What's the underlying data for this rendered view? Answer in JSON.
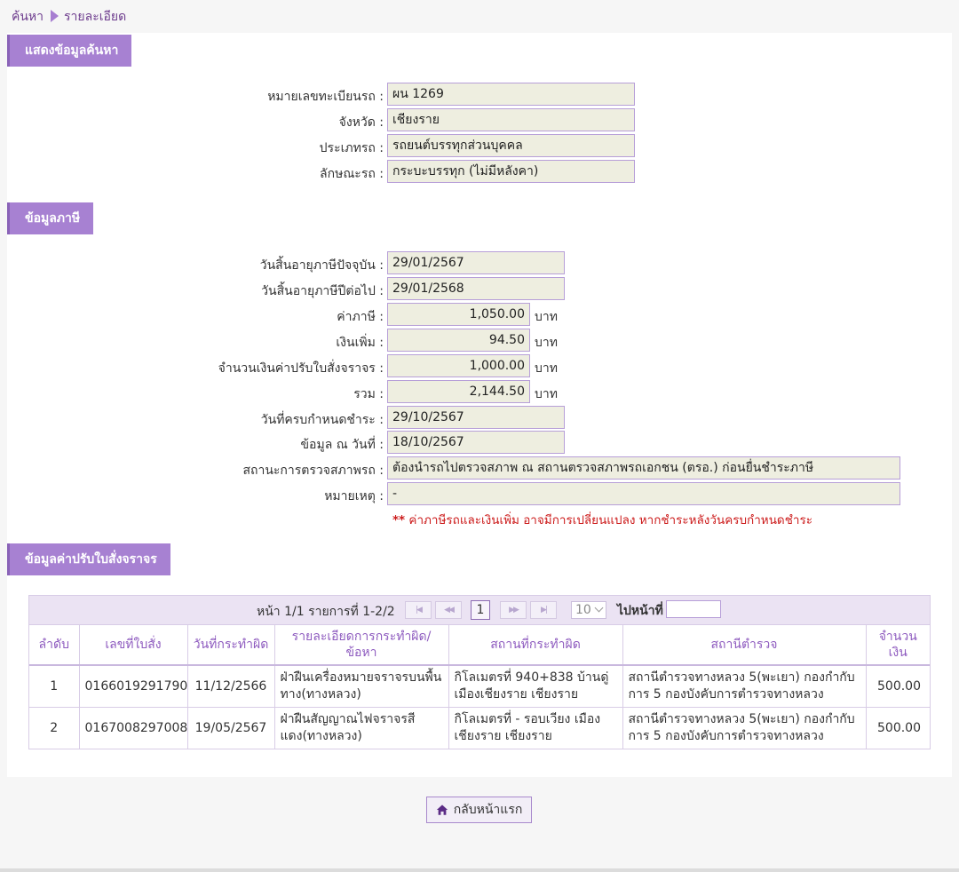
{
  "breadcrumb": {
    "home": "ค้นหา",
    "current": "รายละเอียด"
  },
  "search_section": {
    "title": "แสดงข้อมูลค้นหา",
    "fields": [
      {
        "label": "หมายเลขทะเบียนรถ :",
        "value": "ผน 1269"
      },
      {
        "label": "จังหวัด :",
        "value": "เชียงราย"
      },
      {
        "label": "ประเภทรถ :",
        "value": "รถยนต์บรรทุกส่วนบุคคล"
      },
      {
        "label": "ลักษณะรถ :",
        "value": "กระบะบรรทุก (ไม่มีหลังคา)"
      }
    ]
  },
  "tax_section": {
    "title": "ข้อมูลภาษี",
    "expire_current": {
      "label": "วันสิ้นอายุภาษีปัจจุบัน :",
      "value": "29/01/2567"
    },
    "expire_next": {
      "label": "วันสิ้นอายุภาษีปีต่อไป :",
      "value": "29/01/2568"
    },
    "tax": {
      "label": "ค่าภาษี :",
      "value": "1,050.00",
      "unit": "บาท"
    },
    "surcharge": {
      "label": "เงินเพิ่ม :",
      "value": "94.50",
      "unit": "บาท"
    },
    "fine": {
      "label": "จำนวนเงินค่าปรับใบสั่งจราจร :",
      "value": "1,000.00",
      "unit": "บาท"
    },
    "total": {
      "label": "รวม :",
      "value": "2,144.50",
      "unit": "บาท"
    },
    "due_date": {
      "label": "วันที่ครบกำหนดชำระ :",
      "value": "29/10/2567"
    },
    "as_of": {
      "label": "ข้อมูล ณ วันที่ :",
      "value": "18/10/2567"
    },
    "inspection": {
      "label": "สถานะการตรวจสภาพรถ :",
      "value": "ต้องนำรถไปตรวจสภาพ ณ สถานตรวจสภาพรถเอกชน (ตรอ.) ก่อนยื่นชำระภาษี"
    },
    "remark": {
      "label": "หมายเหตุ :",
      "value": "-"
    },
    "note_prefix": "**",
    "note_text": "ค่าภาษีรถและเงินเพิ่ม อาจมีการเปลี่ยนแปลง หากชำระหลังวันครบกำหนดชำระ"
  },
  "fine_section": {
    "title": "ข้อมูลค่าปรับใบสั่งจราจร",
    "pager": {
      "info": "หน้า 1/1 รายการที่ 1-2/2",
      "current_page": "1",
      "page_size": "10",
      "goto_label": "ไปหน้าที่",
      "first_icon": "first-page-icon",
      "prev_icon": "prev-page-icon",
      "next_icon": "next-page-icon",
      "last_icon": "last-page-icon"
    },
    "columns": [
      "ลำดับ",
      "เลขที่ใบสั่ง",
      "วันที่กระทำผิด",
      "รายละเอียดการกระทำผิด/ข้อหา",
      "สถานที่กระทำผิด",
      "สถานีตำรวจ",
      "จำนวนเงิน"
    ],
    "rows": [
      [
        "1",
        "0166019291790",
        "11/12/2566",
        "ฝ่าฝืนเครื่องหมายจราจรบนพื้นทาง(ทางหลวง)",
        "กิโลเมตรที่ 940+838 บ้านดู่ เมืองเชียงราย เชียงราย",
        "สถานีตำรวจทางหลวง 5(พะเยา) กองกำกับการ 5 กองบังคับการตำรวจทางหลวง",
        "500.00"
      ],
      [
        "2",
        "0167008297008",
        "19/05/2567",
        "ฝ่าฝืนสัญญาณไฟจราจรสีแดง(ทางหลวง)",
        "กิโลเมตรที่ - รอบเวียง เมืองเชียงราย เชียงราย",
        "สถานีตำรวจทางหลวง 5(พะเยา) กองกำกับการ 5 กองบังคับการตำรวจทางหลวง",
        "500.00"
      ]
    ]
  },
  "back_button": {
    "label": "กลับหน้าแรก",
    "icon": "home-icon"
  },
  "colors": {
    "accent": "#a781d2",
    "field_bg": "#eeeee0",
    "warning": "#cc1b1b"
  }
}
